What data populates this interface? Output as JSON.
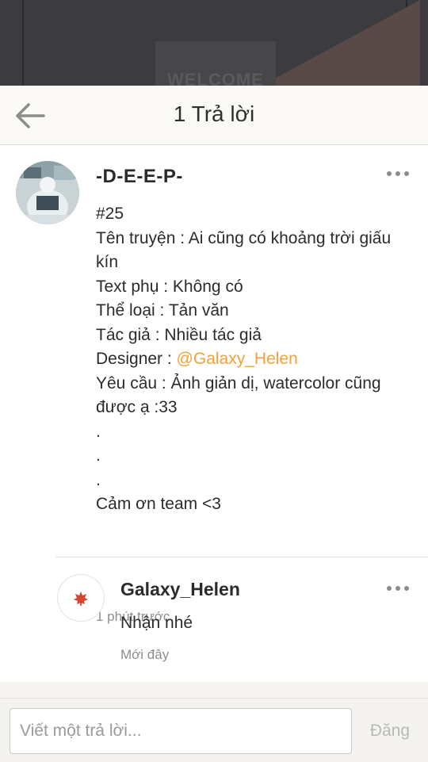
{
  "background": {
    "card_text": "WELCOME"
  },
  "header": {
    "title": "1 Trả lời",
    "back_icon": "arrow-left-icon"
  },
  "comment": {
    "author": "-D-E-E-P-",
    "lines": [
      "#25",
      "Tên truyện : Ai cũng có khoảng trời giấu",
      "kín",
      "Text phụ : Không có",
      "Thể loại : Tản văn",
      "Tác giả : Nhiều tác giả"
    ],
    "designer_label": "Designer : ",
    "designer_mention": "@Galaxy_Helen",
    "lines_after": [
      "Yêu cầu : Ảnh giản dị, watercolor cũng",
      "được ạ :33",
      ".",
      ".",
      ".",
      "Cảm ơn team <3"
    ],
    "time": "1 phút trước",
    "menu_icon": "more-horizontal-icon"
  },
  "reply": {
    "author": "Galaxy_Helen",
    "text": "Nhận nhé",
    "time": "Mới đây",
    "menu_icon": "more-horizontal-icon"
  },
  "composer": {
    "placeholder": "Viết một trả lời...",
    "post_label": "Đăng"
  },
  "colors": {
    "mention": "#f0a13a",
    "post_disabled": "#b9b9b9",
    "muted_text": "#8e8e8e"
  }
}
